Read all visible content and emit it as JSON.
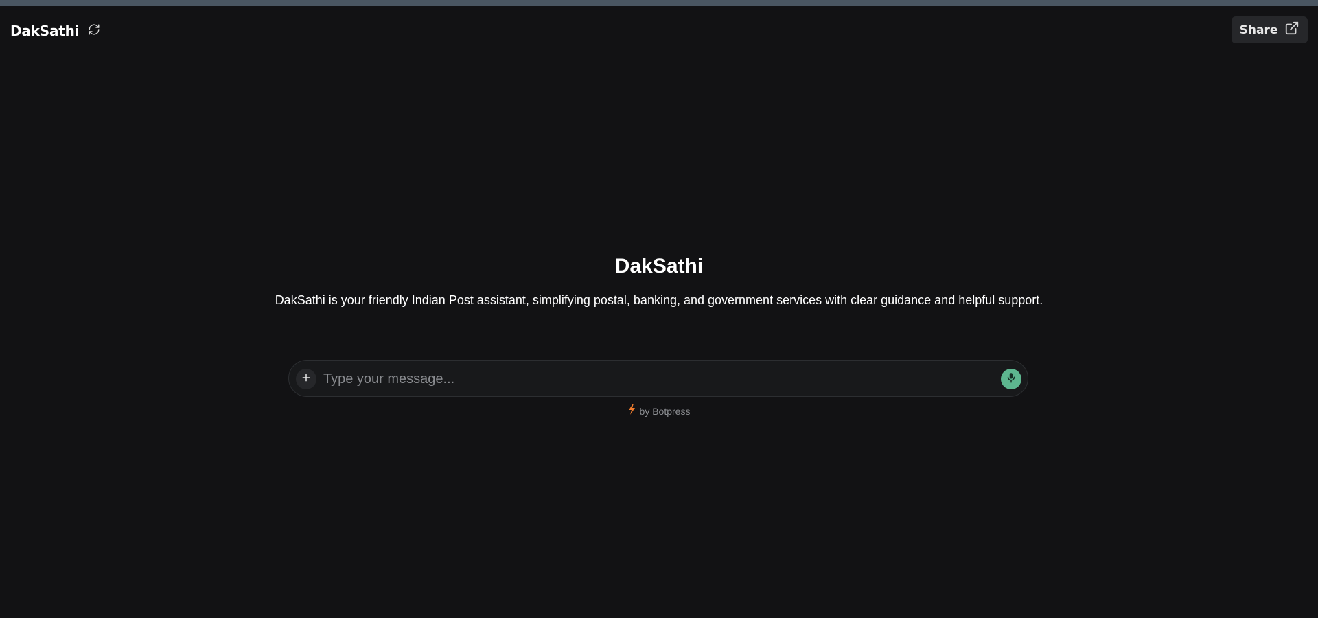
{
  "header": {
    "brand": "DakSathi",
    "share_label": "Share"
  },
  "hero": {
    "title": "DakSathi",
    "description": "DakSathi is your friendly Indian Post assistant, simplifying postal, banking, and government services with clear guidance and helpful support."
  },
  "composer": {
    "placeholder": "Type your message...",
    "value": ""
  },
  "footer": {
    "powered_by": "by Botpress"
  },
  "icons": {
    "refresh": "refresh-icon",
    "share": "external-link-icon",
    "attach": "plus-icon",
    "mic": "microphone-icon",
    "bolt": "lightning-bolt-icon"
  },
  "colors": {
    "background": "#121214",
    "accent_mic": "#5db68f",
    "accent_bolt": "#f07c2d",
    "share_bg": "#26272a"
  }
}
